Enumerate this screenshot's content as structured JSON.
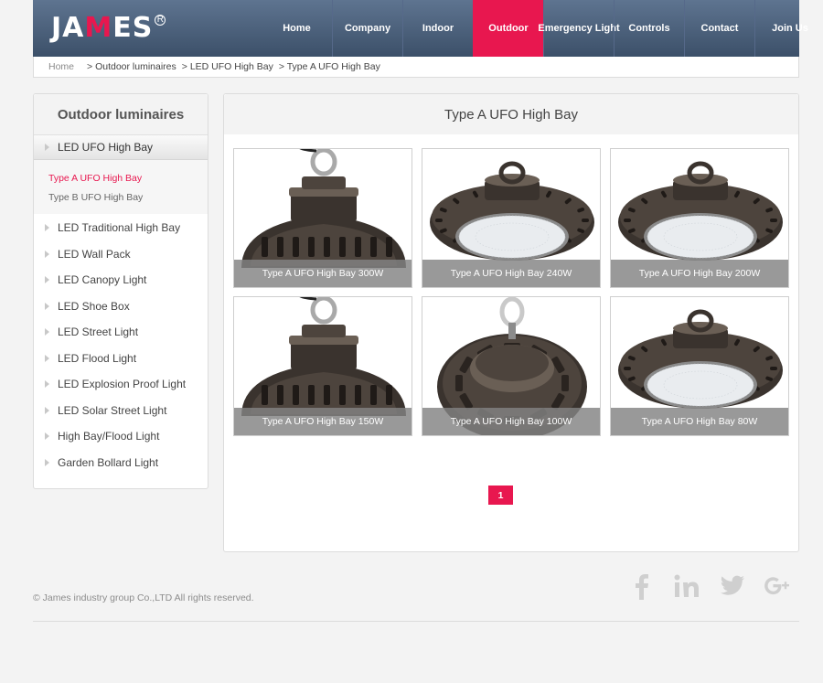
{
  "brand": {
    "logo_left": "JA",
    "logo_m": "M",
    "logo_right": "ES",
    "registered": "R"
  },
  "nav": [
    {
      "label": "Home",
      "active": false
    },
    {
      "label": "Company",
      "active": false
    },
    {
      "label": "Indoor",
      "active": false
    },
    {
      "label": "Outdoor",
      "active": true
    },
    {
      "label": "Emergency Light",
      "active": false
    },
    {
      "label": "Controls",
      "active": false
    },
    {
      "label": "Contact",
      "active": false
    },
    {
      "label": "Join Us",
      "active": false
    }
  ],
  "breadcrumb": {
    "home": "Home",
    "items": [
      "> Outdoor luminaires",
      "> LED UFO High Bay",
      "> Type A UFO High Bay"
    ]
  },
  "sidebar": {
    "title": "Outdoor luminaires",
    "active_item": "LED UFO High Bay",
    "sub_items": [
      {
        "label": "Type A UFO High Bay",
        "active": true
      },
      {
        "label": "Type B UFO High Bay",
        "active": false
      }
    ],
    "items": [
      "LED Traditional High Bay",
      "LED Wall Pack",
      "LED Canopy Light",
      "LED Shoe Box",
      "LED Street Light",
      "LED Flood Light",
      "LED Explosion Proof Light",
      "LED Solar Street Light",
      "High Bay/Flood Light",
      "Garden Bollard Light"
    ]
  },
  "main": {
    "title": "Type A UFO High Bay",
    "products": [
      {
        "caption": "Type A UFO High Bay 300W",
        "view": "side"
      },
      {
        "caption": "Type A UFO High Bay 240W",
        "view": "tilted"
      },
      {
        "caption": "Type A UFO High Bay 200W",
        "view": "tilted"
      },
      {
        "caption": "Type A UFO High Bay 150W",
        "view": "side"
      },
      {
        "caption": "Type A UFO High Bay 100W",
        "view": "top"
      },
      {
        "caption": "Type A UFO High Bay 80W",
        "view": "tilted"
      }
    ],
    "page": "1"
  },
  "footer": {
    "copyright": "© James industry group Co.,LTD All rights reserved.",
    "social": [
      "facebook-icon",
      "linkedin-icon",
      "twitter-icon",
      "google-plus-icon"
    ]
  },
  "colors": {
    "accent": "#e8174f",
    "header": "#4a5e79"
  }
}
